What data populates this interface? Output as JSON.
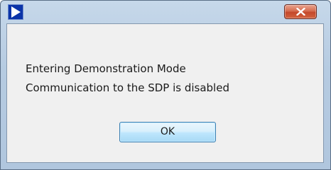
{
  "window": {
    "title": "",
    "icon": "blue-play-arrow-icon",
    "close_icon": "close-x-icon",
    "accent_color": "#0b34a8",
    "close_color": "#c84f33"
  },
  "message": {
    "line1": "Entering Demonstration Mode",
    "line2": "Communication to the SDP is disabled"
  },
  "buttons": {
    "ok_label": "OK"
  }
}
